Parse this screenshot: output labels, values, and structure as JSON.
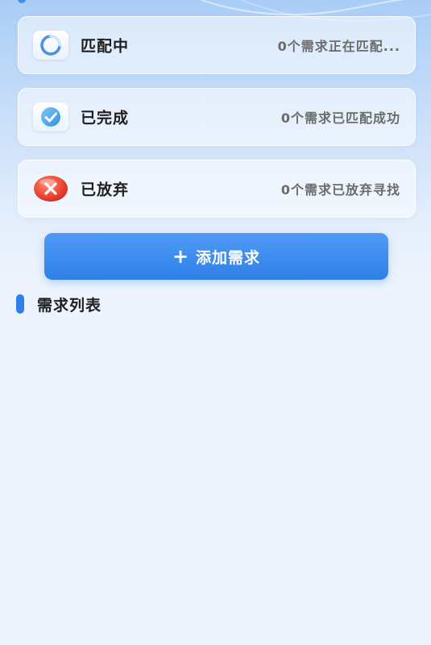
{
  "status_cards": [
    {
      "key": "matching",
      "title": "匹配中",
      "description": "0个需求正在匹配...",
      "icon": "loading-spinner-icon"
    },
    {
      "key": "done",
      "title": "已完成",
      "description": "0个需求已匹配成功",
      "icon": "check-circle-icon"
    },
    {
      "key": "abandoned",
      "title": "已放弃",
      "description": "0个需求已放弃寻找",
      "icon": "close-circle-icon"
    }
  ],
  "add_button": {
    "icon": "plus-icon",
    "label": "添加需求"
  },
  "section": {
    "title": "需求列表"
  },
  "colors": {
    "accent": "#2f7fe8",
    "success": "#3fa9ec",
    "danger": "#e8433a"
  }
}
